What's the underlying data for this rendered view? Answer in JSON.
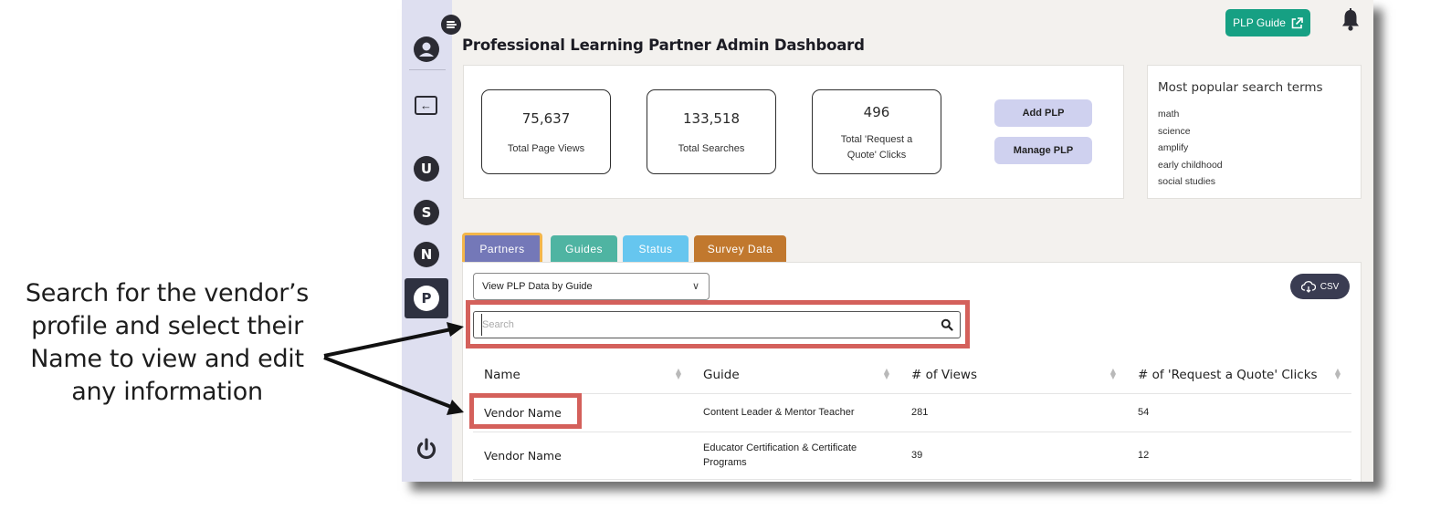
{
  "callout": {
    "lines": [
      "Search for the vendor’s",
      "profile and select their",
      "Name to view and edit",
      "any information"
    ]
  },
  "header": {
    "title": "Professional Learning Partner Admin Dashboard",
    "plp_guide_label": "PLP Guide",
    "icons": [
      "menu-icon",
      "external-link-icon",
      "bell-icon"
    ]
  },
  "rail": {
    "items": [
      {
        "icon": "user-icon"
      },
      {
        "icon": "back-arrow-icon"
      },
      {
        "label": "U"
      },
      {
        "label": "S"
      },
      {
        "label": "N"
      },
      {
        "label": "P",
        "active": true
      },
      {
        "icon": "power-icon"
      }
    ]
  },
  "stats": [
    {
      "value": "75,637",
      "label": "Total Page Views"
    },
    {
      "value": "133,518",
      "label": "Total Searches"
    },
    {
      "value": "496",
      "label_line1": "Total 'Request a",
      "label_line2": "Quote' Clicks"
    }
  ],
  "actions": {
    "add_plp": "Add PLP",
    "manage_plp": "Manage PLP"
  },
  "popular": {
    "title": "Most popular search terms",
    "terms": [
      "math",
      "science",
      "amplify",
      "early childhood",
      "social studies"
    ]
  },
  "tabs": [
    "Partners",
    "Guides",
    "Status",
    "Survey Data"
  ],
  "panel": {
    "select_value": "View PLP Data by Guide",
    "csv_label": "CSV",
    "search_placeholder": "Search"
  },
  "table": {
    "columns": [
      "Name",
      "Guide",
      "# of Views",
      "# of 'Request a Quote' Clicks"
    ],
    "rows": [
      {
        "name": "Vendor Name",
        "guide": "Content Leader & Mentor Teacher",
        "views": "281",
        "clicks": "54"
      },
      {
        "name": "Vendor Name",
        "guide_line1": "Educator Certification & Certificate",
        "guide_line2": "Programs",
        "views": "39",
        "clicks": "12"
      }
    ]
  },
  "colors": {
    "highlight": "#d4605b",
    "rail": "#dedff0",
    "plp_guide_button": "#16a083",
    "tab_partners": "#7478b8",
    "tab_guides": "#4fb4a2",
    "tab_status": "#66c6ef",
    "tab_survey": "#c1782e"
  }
}
